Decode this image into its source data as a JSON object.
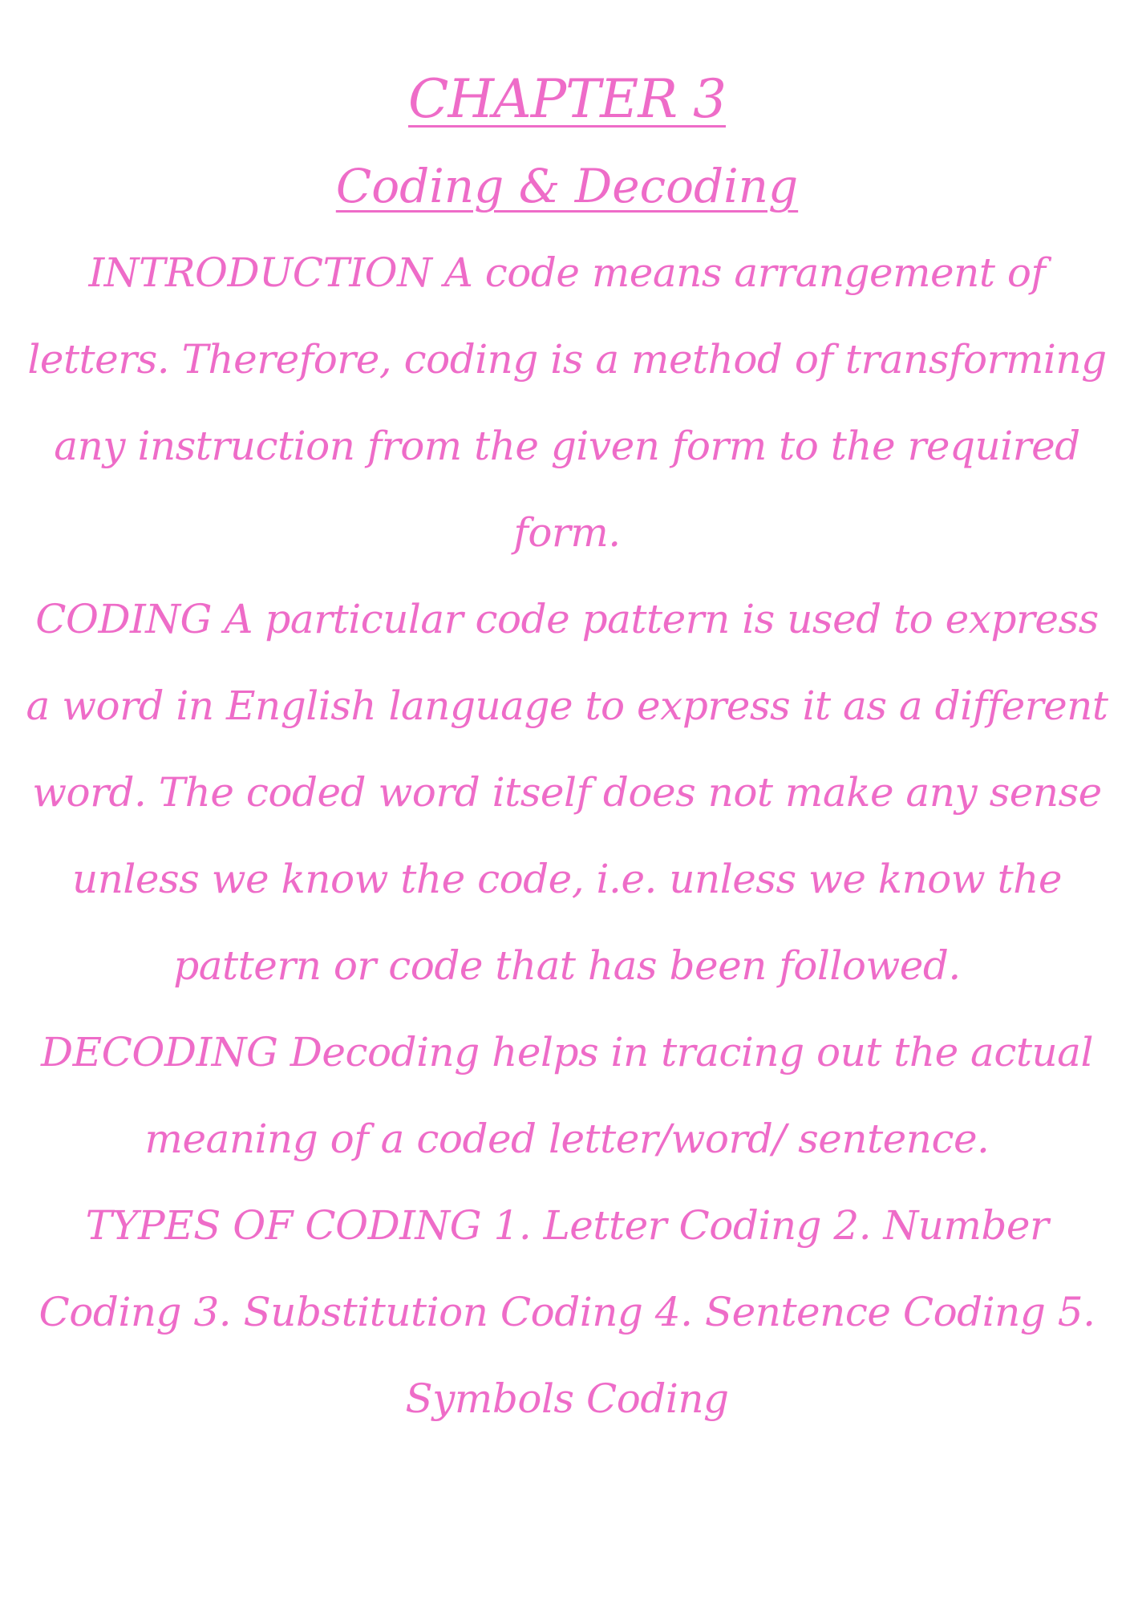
{
  "document": {
    "title": "CHAPTER 3",
    "subtitle": "Coding & Decoding",
    "paragraphs": [
      "INTRODUCTION A code means arrangement of letters. Therefore, coding is a method of transforming any instruction from the given form to the required form.",
      "CODING A particular code pattern is used to express a word in English language to express it as a different word. The coded word itself does not make any sense unless we know the code, i.e. unless we know the pattern or code that has been followed.",
      "DECODING Decoding helps in tracing out the actual meaning of a coded letter/word/ sentence.",
      "TYPES OF CODING 1. Letter Coding 2. Number Coding 3. Substitution Coding 4. Sentence Coding 5. Symbols Coding"
    ]
  },
  "colors": {
    "text": "#ee6cc8",
    "background": "#ffffff"
  }
}
